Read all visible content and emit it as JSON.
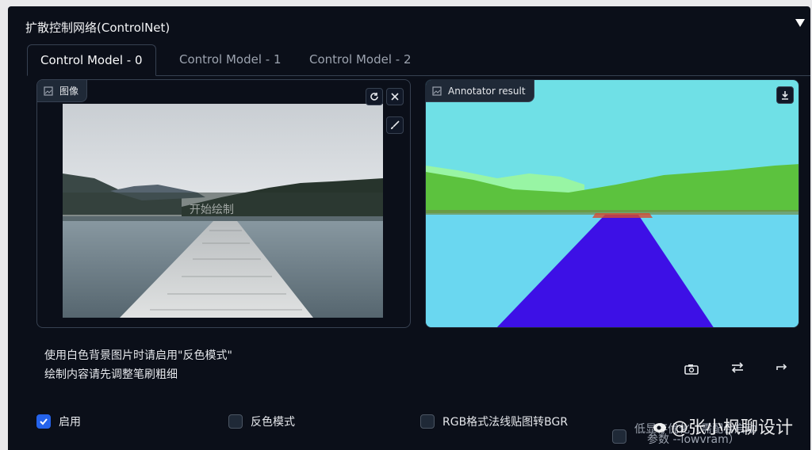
{
  "panel": {
    "title": "扩散控制网络(ControlNet)"
  },
  "tabs": [
    {
      "label": "Control Model - 0",
      "active": true
    },
    {
      "label": "Control Model - 1",
      "active": false
    },
    {
      "label": "Control Model - 2",
      "active": false
    }
  ],
  "input_image": {
    "label": "图像",
    "overlay_text": "开始绘制"
  },
  "annotator": {
    "label": "Annotator result"
  },
  "hints": {
    "line1": "使用白色背景图片时请启用\"反色模式\"",
    "line2": "绘制内容请先调整笔刷粗细"
  },
  "checkboxes": [
    {
      "label": "启用",
      "checked": true
    },
    {
      "label": "反色模式",
      "checked": false
    },
    {
      "label": "RGB格式法线贴图转BGR",
      "checked": false
    },
    {
      "label": "低显存优化（需配合启动",
      "checked": false
    }
  ],
  "overlap_text": "参数 --lowvram）",
  "watermark": {
    "text": "@张小枫聊设计"
  },
  "colors": {
    "panel_bg": "#0b0f19",
    "accent": "#2563eb",
    "seg_sky": "#6fe0e6",
    "seg_water": "#6ad7f0",
    "seg_trees": "#5cc23e",
    "seg_path": "#3d10e6"
  }
}
